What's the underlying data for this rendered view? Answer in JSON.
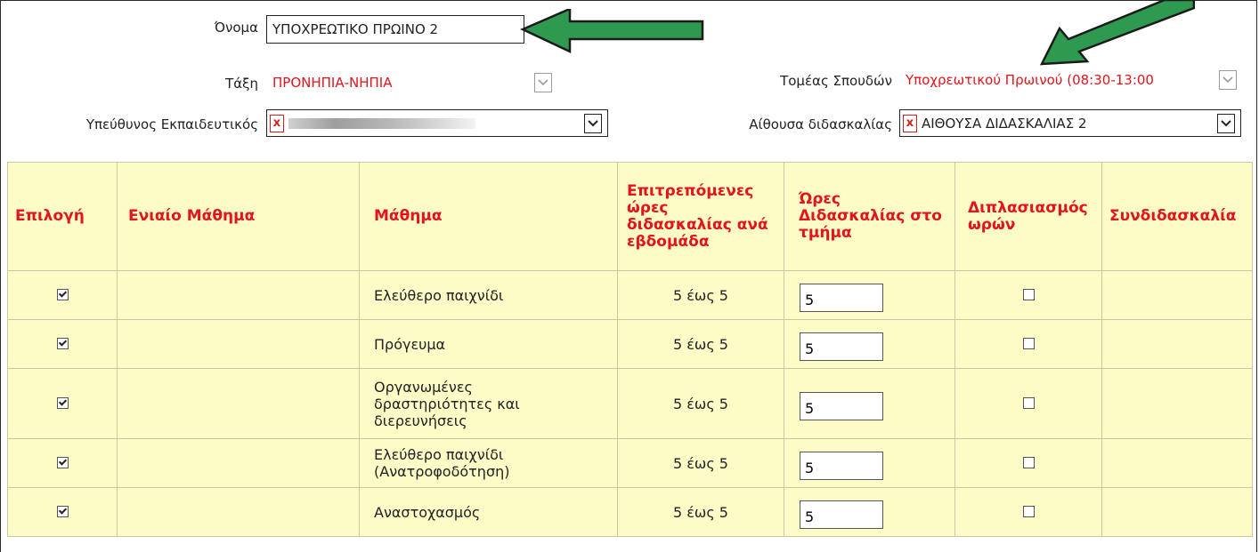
{
  "form": {
    "name_label": "Όνομα",
    "name_value": "ΥΠΟΧΡΕΩΤΙΚΟ ΠΡΩΙΝΟ 2",
    "class_label": "Τάξη",
    "class_value": "ΠΡΟΝΗΠΙΑ-ΝΗΠΙΑ",
    "sector_label": "Τομέας Σπουδών",
    "sector_value": "Υποχρεωτικού Πρωινού (08:30-13:00",
    "teacher_label": "Υπεύθυνος Εκπαιδευτικός",
    "teacher_clear": "x",
    "room_label": "Αίθουσα διδασκαλίας",
    "room_clear": "x",
    "room_value": "ΑΙΘΟΥΣΑ ΔΙΔΑΣΚΑΛΙΑΣ 2"
  },
  "table": {
    "headers": {
      "select": "Επιλογή",
      "unified": "Ενιαίο Μάθημα",
      "subject": "Μάθημα",
      "allowed_hours": "Επιτρεπόμενες ώρες διδασκαλίας ανά εβδομάδα",
      "teaching_hours": "Ώρες Διδασκαλίας στο τμήμα",
      "doubling": "Διπλασιασμός ωρών",
      "co_teaching": "Συνδιδασκαλία"
    },
    "rows": [
      {
        "selected": true,
        "unified": "",
        "subject": "Ελεύθερο παιχνίδι",
        "allowed": "5 έως 5",
        "hours": "5",
        "doubling": false,
        "co_teaching": ""
      },
      {
        "selected": true,
        "unified": "",
        "subject": "Πρόγευμα",
        "allowed": "5 έως 5",
        "hours": "5",
        "doubling": false,
        "co_teaching": ""
      },
      {
        "selected": true,
        "unified": "",
        "subject": "Οργανωμένες δραστηριότητες και διερευνήσεις",
        "allowed": "5 έως 5",
        "hours": "5",
        "doubling": false,
        "co_teaching": ""
      },
      {
        "selected": true,
        "unified": "",
        "subject": "Ελεύθερο παιχνίδι (Ανατροφοδότηση)",
        "allowed": "5 έως 5",
        "hours": "5",
        "doubling": false,
        "co_teaching": ""
      },
      {
        "selected": true,
        "unified": "",
        "subject": "Αναστοχασμός",
        "allowed": "5 έως 5",
        "hours": "5",
        "doubling": false,
        "co_teaching": ""
      }
    ]
  },
  "colors": {
    "header_text": "#e3141b",
    "table_bg": "#fdfbc6",
    "arrow_fill": "#2e9a4f"
  },
  "icons": {
    "dropdown": "chevron-down-icon",
    "clear": "clear-x-icon",
    "checkbox": "checkbox-icon",
    "annotation": "green-arrow-icon"
  }
}
